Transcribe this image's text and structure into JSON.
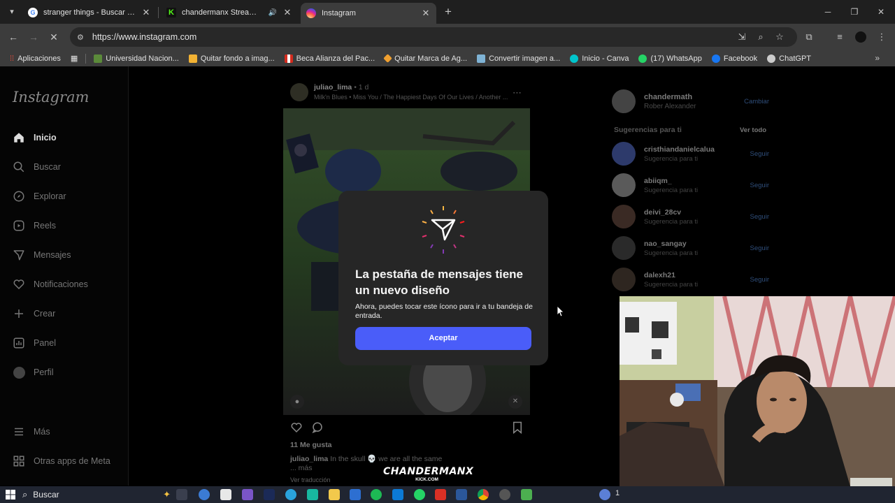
{
  "browser": {
    "tabs": [
      {
        "title": "stranger things - Buscar con Go",
        "favicon_color": "#4285f4"
      },
      {
        "title": "chandermanx Stream - Wat",
        "favicon_color": "#53fc18",
        "audio": true
      },
      {
        "title": "Instagram",
        "favicon_color": "#e1306c",
        "active": true
      }
    ],
    "url": "https://www.instagram.com",
    "bookmarks": [
      {
        "label": "Aplicaciones",
        "icon_color": "#e04c3b"
      },
      {
        "label": "Universidad Nacion...",
        "icon_color": "#5b8a3a"
      },
      {
        "label": "Quitar fondo a imag...",
        "icon_color": "#f2b233"
      },
      {
        "label": "Beca Alianza del Pac...",
        "icon_color": "#d52b1e"
      },
      {
        "label": "Quitar Marca de Ag...",
        "icon_color": "#f0a030"
      },
      {
        "label": "Convertir imagen a...",
        "icon_color": "#7fb3d5"
      },
      {
        "label": "Inicio - Canva",
        "icon_color": "#00c4cc"
      },
      {
        "label": "(17) WhatsApp",
        "icon_color": "#25d366"
      },
      {
        "label": "Facebook",
        "icon_color": "#1877f2"
      },
      {
        "label": "ChatGPT",
        "icon_color": "#cccccc"
      }
    ]
  },
  "instagram": {
    "logo": "Instagram",
    "nav": [
      {
        "label": "Inicio",
        "icon": "home-icon",
        "active": true
      },
      {
        "label": "Buscar",
        "icon": "search-icon"
      },
      {
        "label": "Explorar",
        "icon": "compass-icon"
      },
      {
        "label": "Reels",
        "icon": "reels-icon"
      },
      {
        "label": "Mensajes",
        "icon": "messages-icon"
      },
      {
        "label": "Notificaciones",
        "icon": "heart-icon"
      },
      {
        "label": "Crear",
        "icon": "plus-icon"
      },
      {
        "label": "Panel",
        "icon": "dashboard-icon"
      },
      {
        "label": "Perfil",
        "icon": "profile-icon"
      }
    ],
    "nav_bottom": [
      {
        "label": "Más",
        "icon": "menu-icon"
      },
      {
        "label": "Otras apps de Meta",
        "icon": "apps-icon"
      }
    ],
    "post": {
      "username": "juliao_lima",
      "time": "1 d",
      "audio": "Milk'n Blues • Miss You / The Happiest Days Of Our Lives / Another ...",
      "likes": "11 Me gusta",
      "caption_user": "juliao_lima",
      "caption_text": "In the skull 💀 we are all the same",
      "more": "... más",
      "translation": "Ver traducción"
    },
    "account": {
      "username": "chandermath",
      "name": "Rober Alexander",
      "switch": "Cambiar"
    },
    "suggestions": {
      "title": "Sugerencias para ti",
      "see_all": "Ver todo",
      "items": [
        {
          "name": "cristhiandanielcalua",
          "sub": "Sugerencia para ti",
          "action": "Seguir",
          "color": "#2d3a6b"
        },
        {
          "name": "abiiqm_",
          "sub": "Sugerencia para ti",
          "action": "Seguir",
          "color": "#5a5a5a"
        },
        {
          "name": "deivi_28cv",
          "sub": "Sugerencia para ti",
          "action": "Seguir",
          "color": "#3a2a24"
        },
        {
          "name": "nao_sangay",
          "sub": "Sugerencia para ti",
          "action": "Seguir",
          "color": "#2a2a2a"
        },
        {
          "name": "dalexh21",
          "sub": "Sugerencia para ti",
          "action": "Seguir",
          "color": "#2e2620"
        }
      ]
    }
  },
  "modal": {
    "title": "La pestaña de mensajes tiene un nuevo diseño",
    "body": "Ahora, puedes tocar este ícono para ir a tu bandeja de entrada.",
    "button": "Aceptar",
    "button_color": "#4a5df9"
  },
  "overlay": {
    "watermark": "CHANDERMANX",
    "watermark_sub": "KICK.COM"
  },
  "taskbar": {
    "search": "Buscar",
    "tray_text": "1"
  }
}
